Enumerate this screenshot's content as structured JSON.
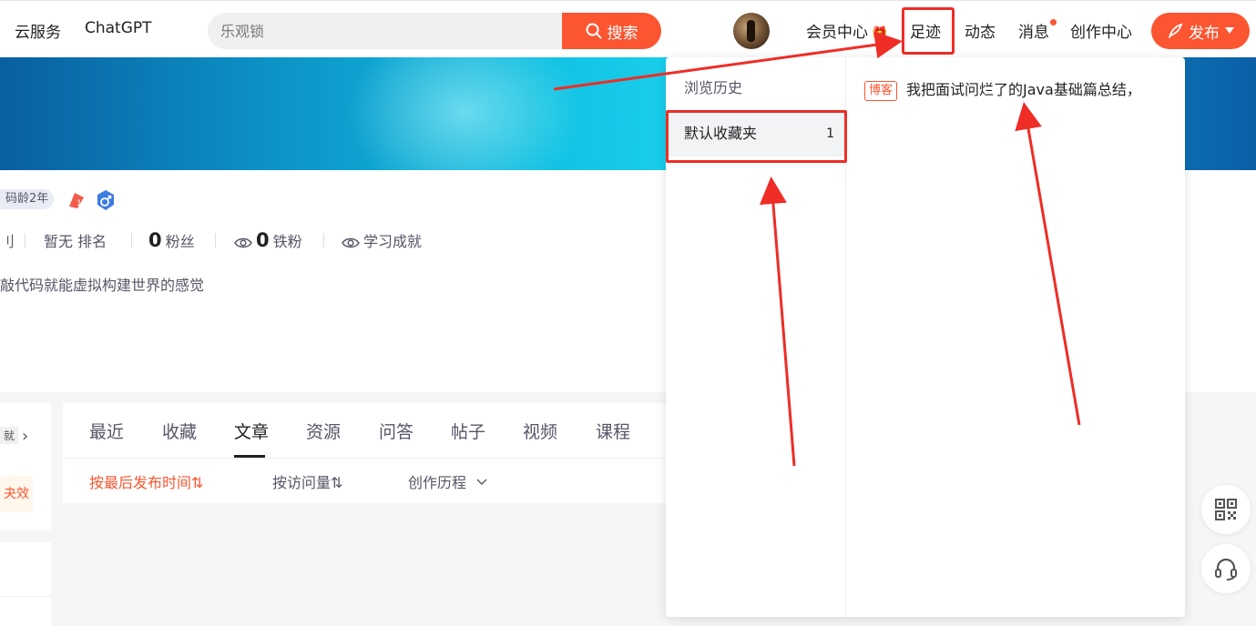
{
  "header": {
    "nav_cloud": "云服务",
    "nav_chatgpt": "ChatGPT",
    "search_placeholder": "乐观锁",
    "search_button": "搜索",
    "member_center": "会员中心",
    "footprint": "足迹",
    "dynamics": "动态",
    "messages": "消息",
    "creation_center": "创作中心",
    "publish": "发布"
  },
  "profile": {
    "code_age": "码龄2年",
    "stat_partial": "刂",
    "rank_label": "暂无 排名",
    "fans_count": "0",
    "fans_label": "粉丝",
    "iron_fans_count": "0",
    "iron_fans_label": "铁粉",
    "achievement_label": "学习成就",
    "bio": "敲代码就能虚拟构建世界的感觉"
  },
  "left_panel": {
    "tag1": "就",
    "tag2": "夬效"
  },
  "tabs": [
    {
      "label": "最近"
    },
    {
      "label": "收藏"
    },
    {
      "label": "文章"
    },
    {
      "label": "资源"
    },
    {
      "label": "问答"
    },
    {
      "label": "帖子"
    },
    {
      "label": "视频"
    },
    {
      "label": "课程"
    }
  ],
  "sort": {
    "by_time": "按最后发布时间⇅",
    "by_views": "按访问量⇅",
    "history": "创作历程"
  },
  "dropdown": {
    "history": "浏览历史",
    "default_folder": "默认收藏夹",
    "default_folder_count": "1",
    "entry_tag": "博客",
    "entry_title": "我把面试问烂了的Java基础篇总结，"
  },
  "colors": {
    "accent": "#fc5531",
    "annotation": "#ee2d26"
  }
}
